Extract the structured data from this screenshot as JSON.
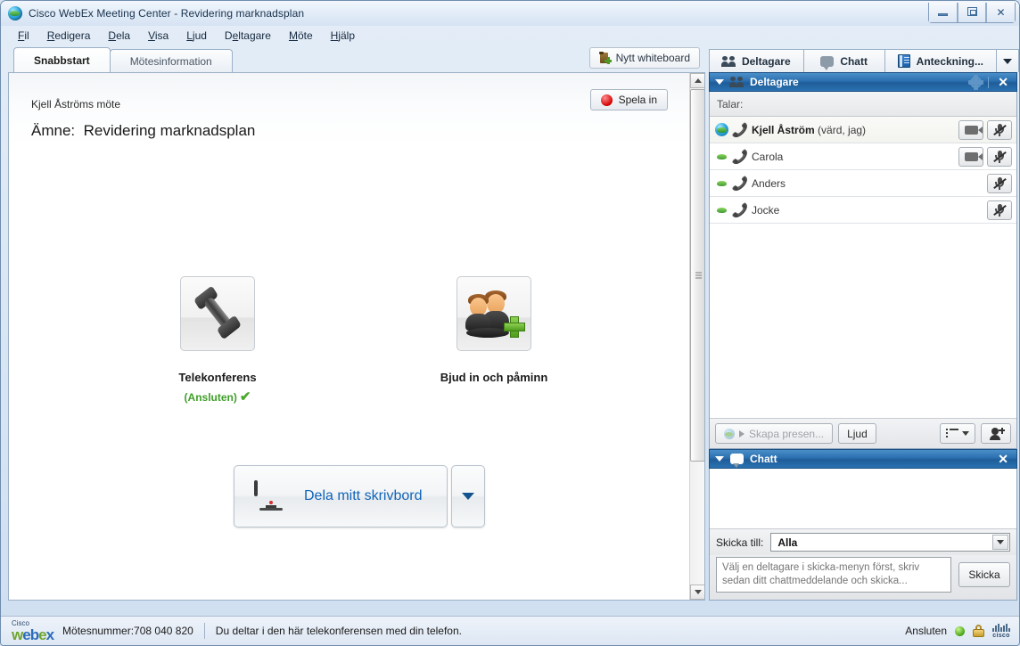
{
  "window": {
    "title": "Cisco WebEx Meeting Center - Revidering marknadsplan",
    "app_icon": "globe-icon",
    "controls": {
      "minimize": "minimize-button",
      "maximize": "maximize-button",
      "close": "✕"
    }
  },
  "menubar": [
    {
      "label": "Fil",
      "accel": "F"
    },
    {
      "label": "Redigera",
      "accel": "R"
    },
    {
      "label": "Dela",
      "accel": "D"
    },
    {
      "label": "Visa",
      "accel": "V"
    },
    {
      "label": "Ljud",
      "accel": "L"
    },
    {
      "label": "Deltagare",
      "accel": "e"
    },
    {
      "label": "Möte",
      "accel": "M"
    },
    {
      "label": "Hjälp",
      "accel": "H"
    }
  ],
  "tabs": [
    {
      "label": "Snabbstart",
      "active": true
    },
    {
      "label": "Mötesinformation",
      "active": false
    }
  ],
  "whiteboard_button": {
    "label": "Nytt whiteboard",
    "icon": "new-whiteboard-icon"
  },
  "panel_tabs": [
    {
      "label": "Deltagare",
      "icon": "people-icon"
    },
    {
      "label": "Chatt",
      "icon": "chat-bubble-icon"
    },
    {
      "label": "Anteckning...",
      "icon": "notes-icon"
    },
    {
      "label": "",
      "icon": "chevron-down-icon"
    }
  ],
  "quickstart": {
    "meeting_name": "Kjell Åströms möte",
    "topic_label": "Ämne:",
    "topic_value": "Revidering marknadsplan",
    "record_button": "Spela in",
    "tiles": [
      {
        "label": "Telekonferens",
        "status": "(Ansluten)",
        "icon": "telephone-handset-icon",
        "checked": true
      },
      {
        "label": "Bjud in och påminn",
        "status": "",
        "icon": "invite-people-icon",
        "checked": false
      }
    ],
    "share_button": {
      "label": "Dela mitt skrivbord",
      "icon": "monitor-icon"
    },
    "share_dropdown": "chevron-down-icon"
  },
  "participants_panel": {
    "title": "Deltagare",
    "speaking_label": "Talar:",
    "rows": [
      {
        "name": "Kjell Åström",
        "role": "(värd, jag)",
        "host": true,
        "globe": true,
        "phone": true,
        "video": true,
        "mic_muted": true
      },
      {
        "name": "Carola",
        "role": "",
        "host": false,
        "globe": false,
        "phone": true,
        "video": true,
        "mic_muted": true
      },
      {
        "name": "Anders",
        "role": "",
        "host": false,
        "globe": false,
        "phone": true,
        "video": false,
        "mic_muted": true
      },
      {
        "name": "Jocke",
        "role": "",
        "host": false,
        "globe": false,
        "phone": true,
        "video": false,
        "mic_muted": true
      }
    ],
    "toolbar": {
      "make_presenter": "Skapa presen...",
      "audio": "Ljud",
      "list_view": "list-view-icon",
      "invite": "add-participant-icon"
    }
  },
  "chat_panel": {
    "title": "Chatt",
    "send_to_label": "Skicka till:",
    "send_to_value": "Alla",
    "message_placeholder": "Välj en deltagare i skicka-menyn först, skriv sedan ditt chattmeddelande och skicka...",
    "send_button": "Skicka"
  },
  "statusbar": {
    "brand_cisco": "Cisco",
    "brand_webex": "webex",
    "meeting_number": "Mötesnummer:708 040 820",
    "message": "Du deltar i den här telekonferensen med din telefon.",
    "connection_status": "Ansluten",
    "indicators": [
      "green-status-dot",
      "lock-icon",
      "cisco-logo"
    ]
  },
  "colors": {
    "panel_header_blue": "#2a6fae",
    "link_blue": "#1064b8",
    "connected_green": "#3fa02a",
    "record_red": "#d40000"
  }
}
